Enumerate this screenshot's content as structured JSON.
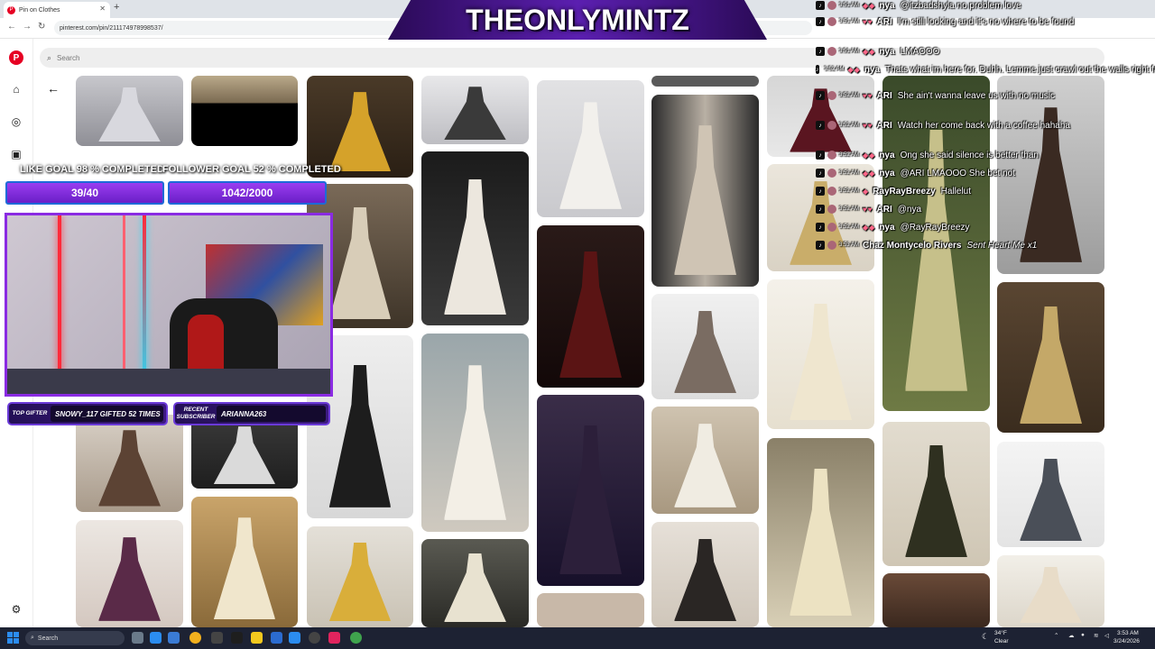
{
  "browser": {
    "tab_title": "Pin on Clothes",
    "url": "pinterest.com/pin/211174978998537/"
  },
  "search": {
    "placeholder": "Search"
  },
  "overlay": {
    "title": "THEONLYMINTZ",
    "goal1_label": "LIKE GOAL 98 % COMPLETED",
    "goal1_value": "39/40",
    "goal2_label": "FOLLOWER GOAL 52 % COMPLETED",
    "goal2_value": "1042/2000",
    "top_gifter_label": "TOP GIFTER",
    "top_gifter_value": "SNOWY_117 GIFTED 52 TIMES",
    "recent_sub_label": "RECENT SUBSCRIBER",
    "recent_sub_value": "ARIANNA263"
  },
  "chat": [
    {
      "time": "3:51 AM",
      "name": "nya",
      "text": "@itzbadshyla no problem love"
    },
    {
      "time": "3:51 AM",
      "name": "ARI",
      "text": "I'm still looking and it's no where to be found"
    },
    {
      "time": "3:51 AM",
      "name": "nya",
      "text": "LMAOOO"
    },
    {
      "time": "3:52 AM",
      "name": "nya",
      "text": "Thats what im here for. Duhh. Lemme just crawl out the walls right fast"
    },
    {
      "time": "3:52 AM",
      "name": "ARI",
      "text": "She ain't wanna leave us with no music"
    },
    {
      "time": "3:52 AM",
      "name": "ARI",
      "text": "Watch her come back with a coffee hahaha"
    },
    {
      "time": "3:52 AM",
      "name": "nya",
      "text": "Ong she said silence is better than"
    },
    {
      "time": "3:52 AM",
      "name": "nya",
      "text": "@ARI LMAOOO She bet not"
    },
    {
      "time": "3:52 AM",
      "name": "RayRayBreezy",
      "text": "Hallelut"
    },
    {
      "time": "3:52 AM",
      "name": "ARI",
      "text": "@nya"
    },
    {
      "time": "3:52 AM",
      "name": "nya",
      "text": "@RayRayBreezy"
    },
    {
      "time": "3:53 AM",
      "name": "Chaz Montycelo Rivers",
      "text": "Sent Heart Me x1"
    }
  ],
  "taskbar": {
    "search_label": "Search",
    "weather_temp": "34°F",
    "weather_cond": "Clear",
    "time": "3:53 AM",
    "date": "3/24/2026"
  },
  "colors": {
    "accent_purple": "#8a2be2",
    "pinterest_red": "#e60023",
    "taskbar": "#1d2233"
  }
}
